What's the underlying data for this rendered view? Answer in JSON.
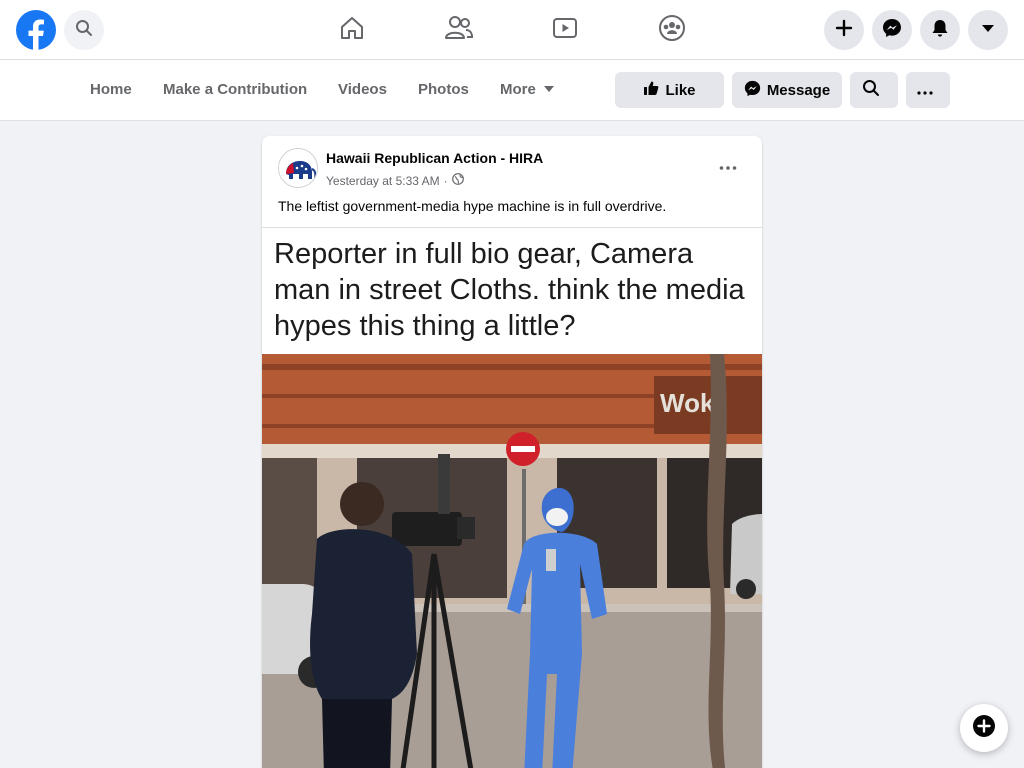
{
  "topnav": {
    "logo_icon": "facebook-logo-icon",
    "search_icon": "search-icon",
    "tabs": [
      {
        "name": "home",
        "icon": "home-icon"
      },
      {
        "name": "friends",
        "icon": "friends-icon"
      },
      {
        "name": "watch",
        "icon": "watch-icon"
      },
      {
        "name": "groups",
        "icon": "groups-icon"
      }
    ],
    "right_buttons": [
      {
        "name": "create",
        "icon": "plus-icon"
      },
      {
        "name": "messenger",
        "icon": "messenger-icon"
      },
      {
        "name": "notifications",
        "icon": "bell-icon"
      },
      {
        "name": "account",
        "icon": "caret-down-icon"
      }
    ],
    "brand_color": "#1877f2"
  },
  "pagebar": {
    "tabs": [
      "Home",
      "Make a Contribution",
      "Videos",
      "Photos",
      "More"
    ],
    "like_label": "Like",
    "message_label": "Message",
    "search_icon": "search-icon",
    "more_icon": "ellipsis-icon"
  },
  "post": {
    "author": "Hawaii Republican Action - HIRA",
    "time": "Yesterday at 5:33 AM",
    "separator": "·",
    "privacy_icon": "globe-icon",
    "text": "The leftist government-media hype machine is in full overdrive.",
    "meme_lines": [
      "Reporter in full bio gear, Camera",
      "man in street Cloths. think the media",
      "hypes this thing a little?"
    ],
    "photo_sign_text": "Wok"
  },
  "floating": {
    "icon": "new-message-icon"
  }
}
